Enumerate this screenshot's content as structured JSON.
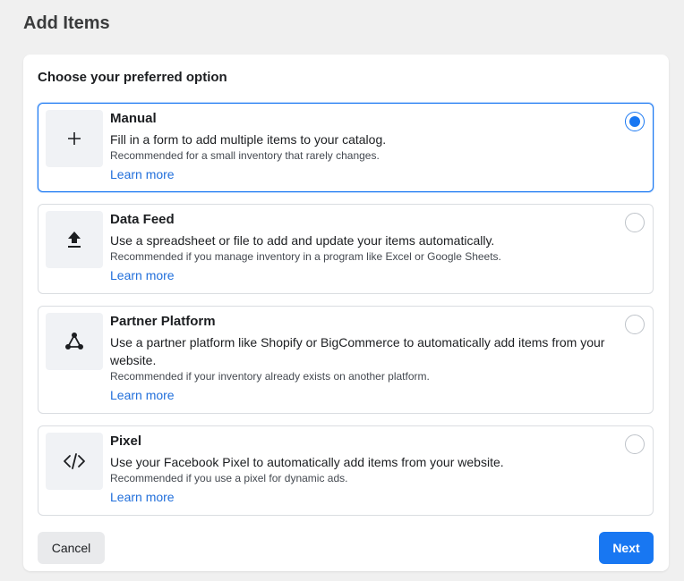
{
  "page": {
    "title": "Add Items"
  },
  "card": {
    "heading": "Choose your preferred option",
    "options": [
      {
        "title": "Manual",
        "description": "Fill in a form to add multiple items to your catalog.",
        "recommendation": "Recommended for a small inventory that rarely changes.",
        "link": "Learn more",
        "icon": "plus-icon",
        "selected": true
      },
      {
        "title": "Data Feed",
        "description": "Use a spreadsheet or file to add and update your items automatically.",
        "recommendation": "Recommended if you manage inventory in a program like Excel or Google Sheets.",
        "link": "Learn more",
        "icon": "upload-icon",
        "selected": false
      },
      {
        "title": "Partner Platform",
        "description": "Use a partner platform like Shopify or BigCommerce to automatically add items from your website.",
        "recommendation": "Recommended if your inventory already exists on another platform.",
        "link": "Learn more",
        "icon": "network-nodes-icon",
        "selected": false
      },
      {
        "title": "Pixel",
        "description": "Use your Facebook Pixel to automatically add items from your website.",
        "recommendation": "Recommended if you use a pixel for dynamic ads.",
        "link": "Learn more",
        "icon": "code-icon",
        "selected": false
      }
    ]
  },
  "footer": {
    "cancel_label": "Cancel",
    "next_label": "Next"
  },
  "colors": {
    "accent": "#1877f2",
    "link": "#216fdb",
    "background": "#f0f0f0"
  }
}
